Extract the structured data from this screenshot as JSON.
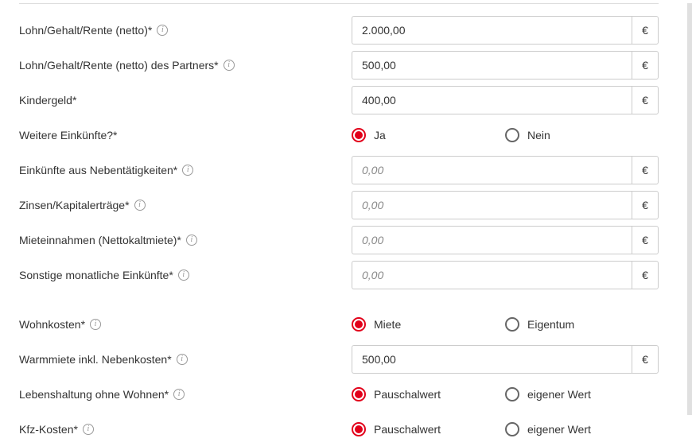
{
  "currency_symbol": "€",
  "info_glyph": "i",
  "placeholder_zero": "0,00",
  "rows": {
    "lohn_self": {
      "label": "Lohn/Gehalt/Rente (netto)*",
      "value": "2.000,00",
      "has_info": true
    },
    "lohn_partner": {
      "label": "Lohn/Gehalt/Rente (netto) des Partners*",
      "value": "500,00",
      "has_info": true
    },
    "kindergeld": {
      "label": "Kindergeld*",
      "value": "400,00",
      "has_info": false
    },
    "weitere_einkuenfte": {
      "label": "Weitere Einkünfte?*",
      "opt1": "Ja",
      "opt2": "Nein",
      "selected": 1
    },
    "nebentaetigkeiten": {
      "label": "Einkünfte aus Nebentätigkeiten*",
      "value": "",
      "has_info": true
    },
    "zinsen": {
      "label": "Zinsen/Kapitalerträge*",
      "value": "",
      "has_info": true
    },
    "mieteinnahmen": {
      "label": "Mieteinnahmen (Nettokaltmiete)*",
      "value": "",
      "has_info": true
    },
    "sonstige": {
      "label": "Sonstige monatliche Einkünfte*",
      "value": "",
      "has_info": true
    },
    "wohnkosten": {
      "label": "Wohnkosten*",
      "opt1": "Miete",
      "opt2": "Eigentum",
      "selected": 1,
      "has_info": true
    },
    "warmmiete": {
      "label": "Warmmiete inkl. Nebenkosten*",
      "value": "500,00",
      "has_info": true
    },
    "lebenshaltung": {
      "label": "Lebenshaltung ohne Wohnen*",
      "opt1": "Pauschalwert",
      "opt2": "eigener Wert",
      "selected": 1,
      "has_info": true
    },
    "kfz": {
      "label": "Kfz-Kosten*",
      "opt1": "Pauschalwert",
      "opt2": "eigener Wert",
      "selected": 1,
      "has_info": true
    }
  }
}
